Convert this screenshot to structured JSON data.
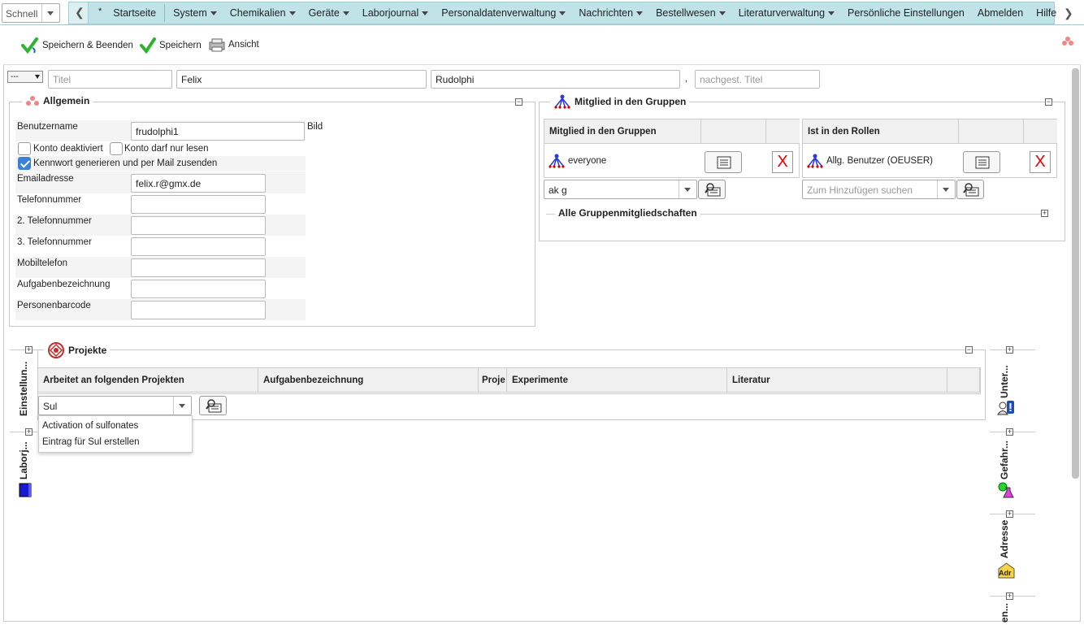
{
  "nav": {
    "quick_label": "Schnell",
    "star": "*",
    "items": [
      {
        "label": "Startseite",
        "has_menu": false
      },
      {
        "label": "System",
        "has_menu": true
      },
      {
        "label": "Chemikalien",
        "has_menu": true
      },
      {
        "label": "Geräte",
        "has_menu": true
      },
      {
        "label": "Laborjournal",
        "has_menu": true
      },
      {
        "label": "Personaldatenverwaltung",
        "has_menu": true
      },
      {
        "label": "Nachrichten",
        "has_menu": true
      },
      {
        "label": "Bestellwesen",
        "has_menu": true
      },
      {
        "label": "Literaturverwaltung",
        "has_menu": true
      },
      {
        "label": "Persönliche Einstellungen",
        "has_menu": false
      },
      {
        "label": "Abmelden",
        "has_menu": false
      },
      {
        "label": "Hilfe",
        "has_menu": false
      }
    ],
    "bar_color": "#bfe3e6"
  },
  "toolbar": {
    "save_close_label": "Speichern & Beenden",
    "save_label": "Speichern",
    "view_label": "Ansicht"
  },
  "name_row": {
    "salutation_value": "---",
    "title_placeholder": "Titel",
    "first_name": "Felix",
    "last_name": "Rudolphi",
    "comma": ",",
    "post_title_placeholder": "nachgest. Titel"
  },
  "general": {
    "legend": "Allgemein",
    "username_label": "Benutzername",
    "username_value": "frudolphi1",
    "image_label": "Bild",
    "account_disabled_label": "Konto deaktiviert",
    "account_readonly_label": "Konto darf nur lesen",
    "generate_password_label": "Kennwort generieren und per Mail zusenden",
    "account_disabled_checked": false,
    "account_readonly_checked": false,
    "generate_password_checked": true,
    "email_label": "Emailadresse",
    "email_value": "felix.r@gmx.de",
    "phone_label": "Telefonnummer",
    "phone2_label": "2. Telefonnummer",
    "phone3_label": "3. Telefonnummer",
    "mobile_label": "Mobiltelefon",
    "job_label": "Aufgabenbezeichnung",
    "barcode_label": "Personenbarcode"
  },
  "groups": {
    "legend": "Mitglied in den Gruppen",
    "col_groups": "Mitglied in den Gruppen",
    "col_roles": "Ist in den Rollen",
    "group_row": "everyone",
    "role_row": "Allg. Benutzer (OEUSER)",
    "delete_glyph": "X",
    "group_search_value": "ak g",
    "role_search_placeholder": "Zum Hinzufügen suchen",
    "all_memberships_legend": "Alle Gruppenmitgliedschaften"
  },
  "projects": {
    "legend": "Projekte",
    "columns": [
      "Arbeitet an folgenden Projekten",
      "Aufgabenbezeichnung",
      "Proje",
      "Experimente",
      "Literatur"
    ],
    "search_value": "Sul",
    "dropdown_options": [
      "Activation of sulfonates",
      "Eintrag für Sul erstellen"
    ]
  },
  "side_tabs": {
    "left": [
      "Einstellun...",
      "Laborj..."
    ],
    "right": [
      "Unter...",
      "Gefahr...",
      "Adresse",
      "en..."
    ],
    "address_icon_text": "Adr"
  }
}
